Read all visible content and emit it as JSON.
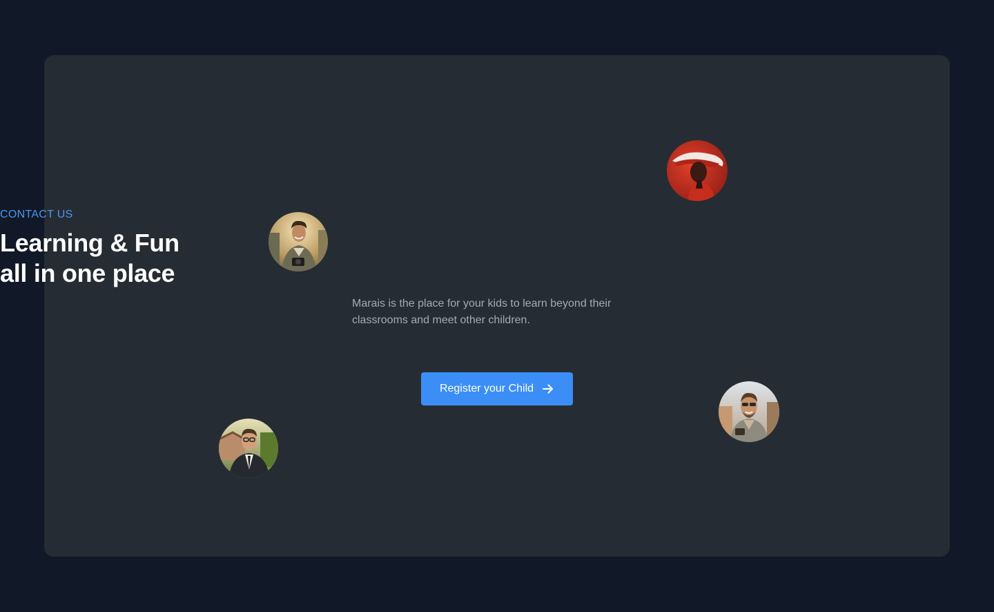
{
  "hero": {
    "eyebrow": "CONTACT US",
    "headline_line1": "Learning & Fun",
    "headline_line2": "all in one place",
    "description": "Marais is the place for your kids to learn beyond their classrooms and meet other children."
  },
  "cta": {
    "label": "Register your Child",
    "icon": "arrow-right-icon"
  },
  "avatars": [
    {
      "name": "avatar-woman-red-hat",
      "description": "photo"
    },
    {
      "name": "avatar-man-camera",
      "description": "photo"
    },
    {
      "name": "avatar-man-sunglasses",
      "description": "photo"
    },
    {
      "name": "avatar-man-suit",
      "description": "photo"
    }
  ],
  "colors": {
    "page_background": "#111827",
    "card_background": "#262c33",
    "accent": "#3b8ef6",
    "eyebrow": "#4b97f0",
    "headline": "#ffffff",
    "body_text": "#a3aab4"
  }
}
